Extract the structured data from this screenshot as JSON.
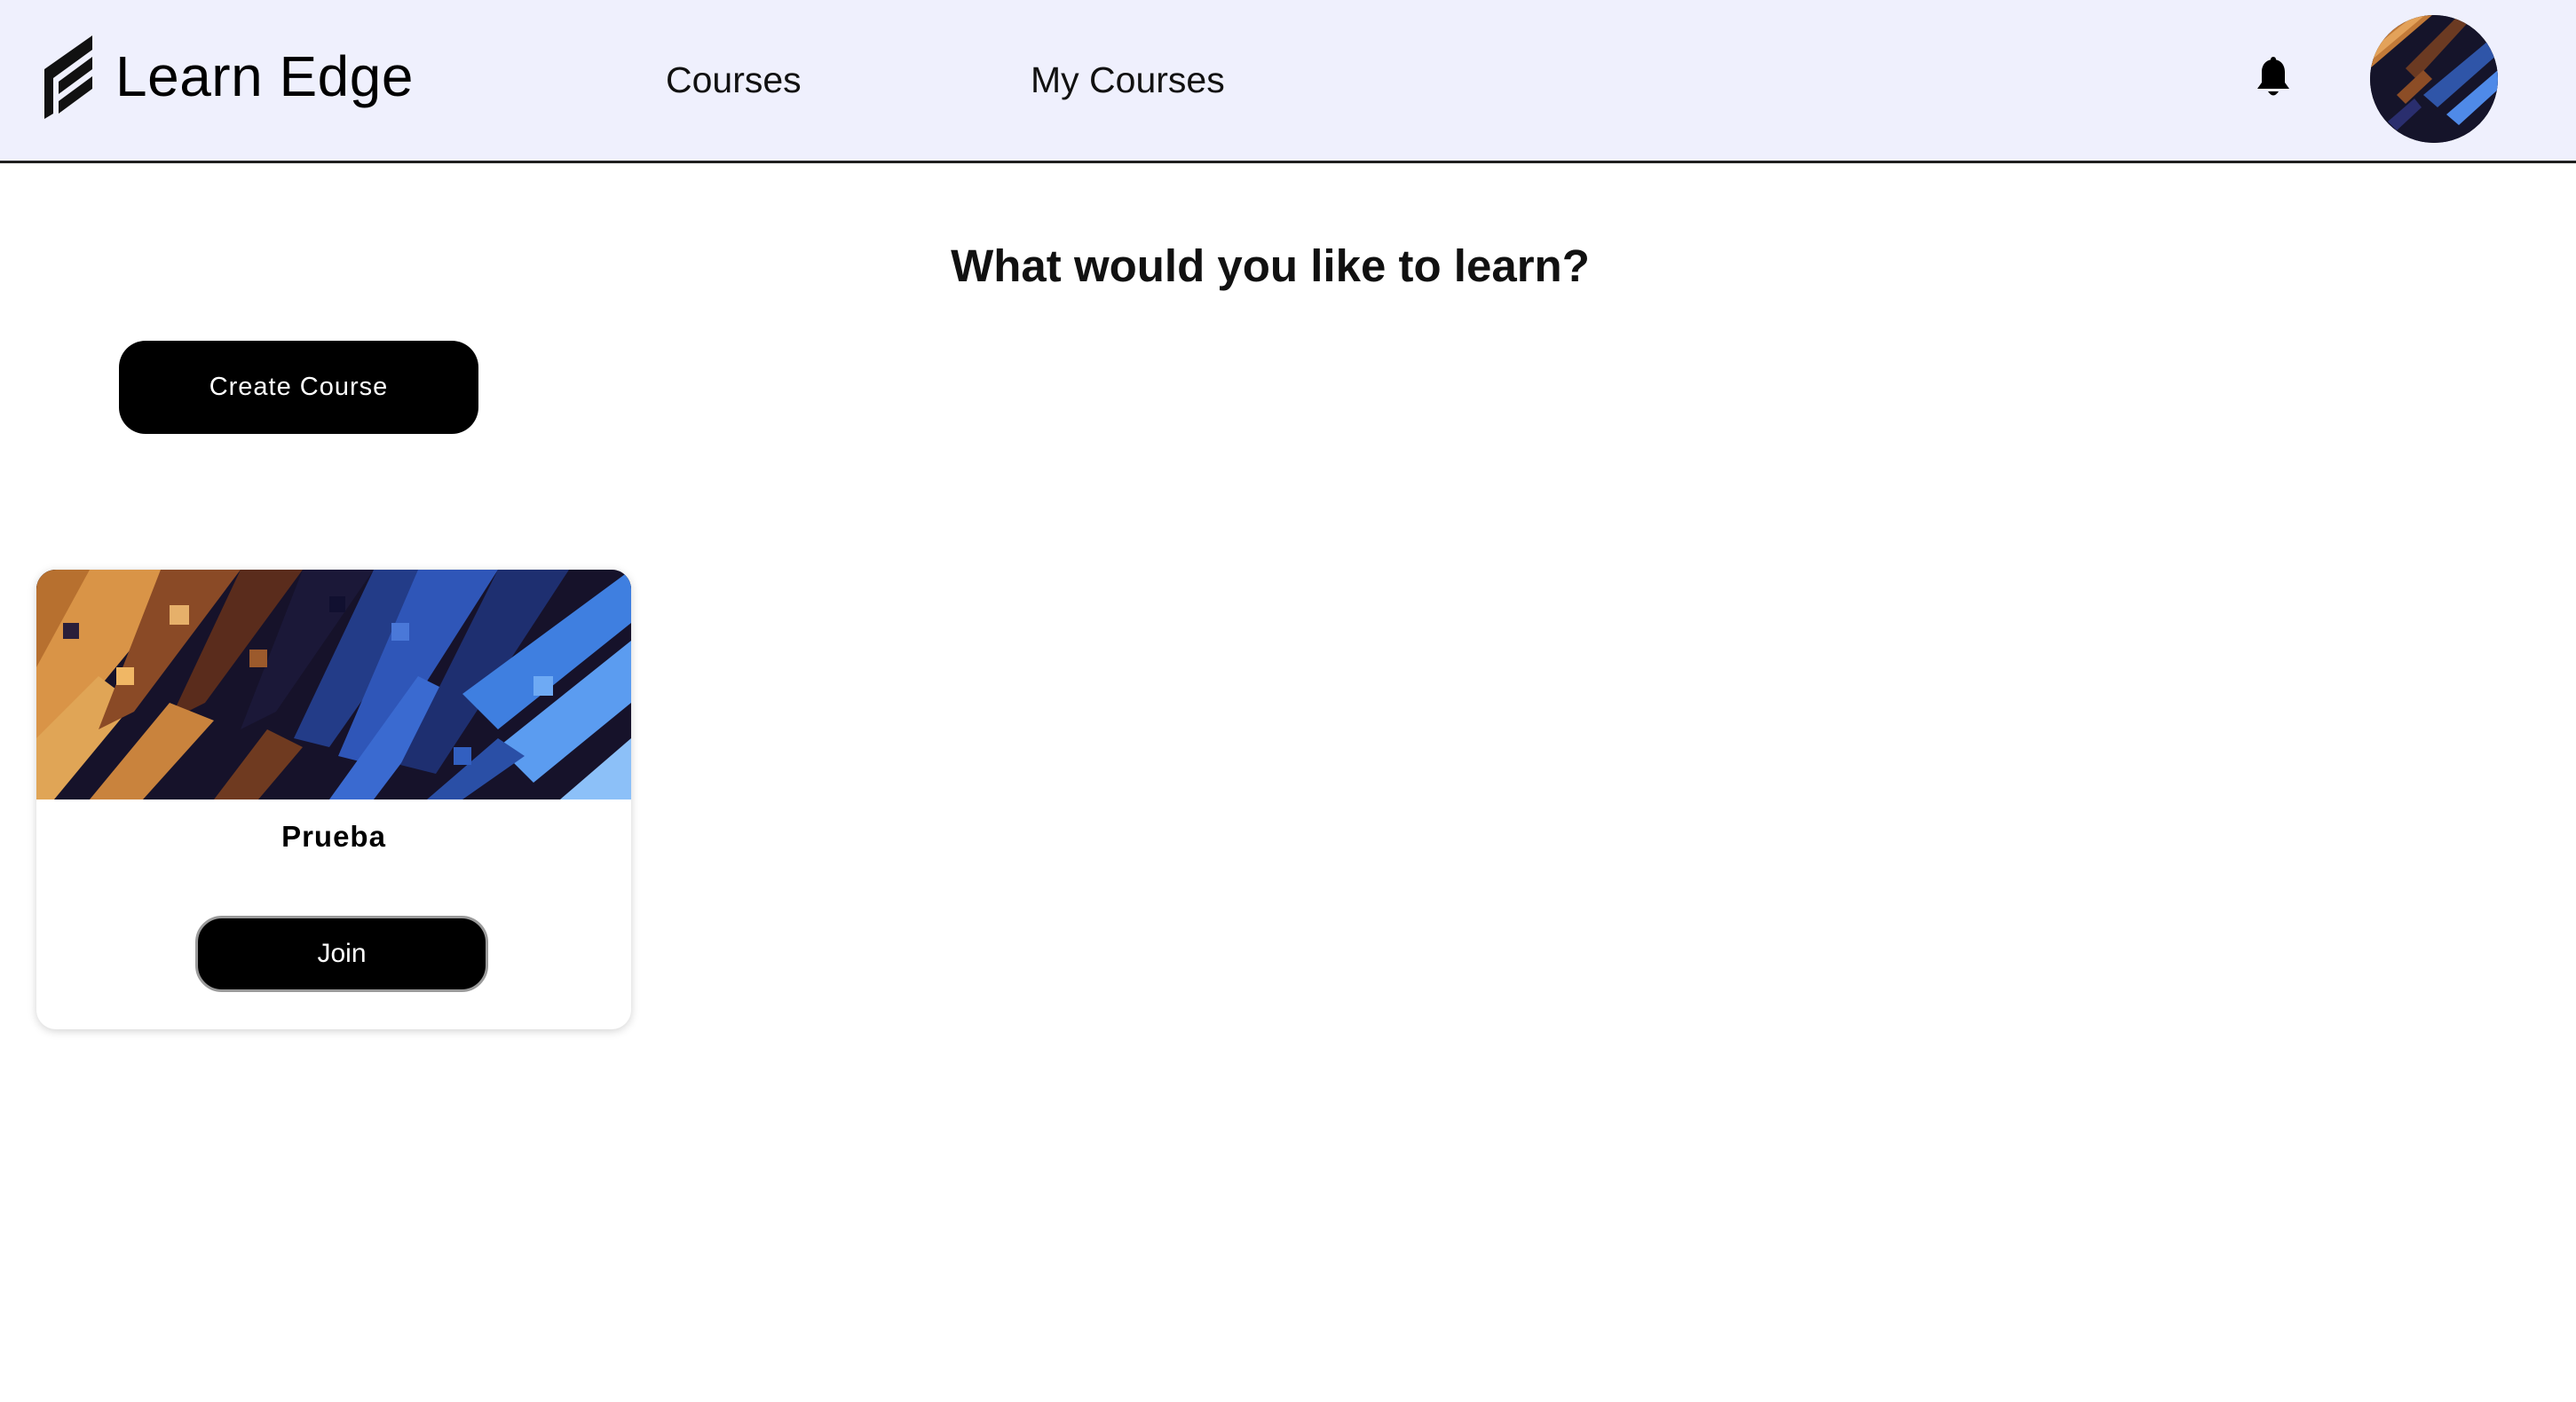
{
  "header": {
    "brand_name": "Learn Edge",
    "logo_icon": "learn-edge-logo-icon",
    "nav": {
      "courses_label": "Courses",
      "my_courses_label": "My Courses"
    },
    "notification_icon": "bell-icon",
    "avatar_icon": "user-avatar",
    "background_color": "#eff0fd"
  },
  "main": {
    "heading": "What would you like to learn?",
    "create_course_label": "Create Course",
    "courses": [
      {
        "title": "Prueba",
        "join_label": "Join",
        "image": "abstract-orange-blue-pattern"
      }
    ]
  },
  "colors": {
    "button_bg": "#000000",
    "button_text": "#ffffff",
    "pattern_dark": "#16122a",
    "pattern_orange": "#d38a3e",
    "pattern_blue": "#3f7fe0"
  }
}
